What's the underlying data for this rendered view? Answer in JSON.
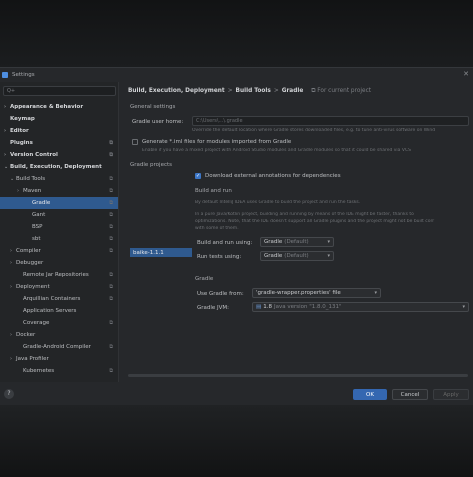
{
  "window": {
    "title": "Settings"
  },
  "search": {
    "placeholder": "Q+"
  },
  "tree": [
    {
      "label": "Appearance & Behavior",
      "level": 0,
      "arrow": ">",
      "bold": true
    },
    {
      "label": "Keymap",
      "level": 0,
      "bold": true
    },
    {
      "label": "Editor",
      "level": 0,
      "arrow": ">",
      "bold": true
    },
    {
      "label": "Plugins",
      "level": 0,
      "bold": true,
      "gear": true
    },
    {
      "label": "Version Control",
      "level": 0,
      "arrow": ">",
      "bold": true,
      "gear": true
    },
    {
      "label": "Build, Execution, Deployment",
      "level": 0,
      "arrow": "v",
      "bold": true
    },
    {
      "label": "Build Tools",
      "level": 1,
      "arrow": "v",
      "gear": true
    },
    {
      "label": "Maven",
      "level": 2,
      "arrow": ">",
      "gear": true
    },
    {
      "label": "Gradle",
      "level": 3,
      "selected": true,
      "gear": true
    },
    {
      "label": "Gant",
      "level": 3,
      "gear": true
    },
    {
      "label": "BSP",
      "level": 3,
      "gear": true
    },
    {
      "label": "sbt",
      "level": 3,
      "gear": true
    },
    {
      "label": "Compiler",
      "level": 1,
      "arrow": ">",
      "gear": true
    },
    {
      "label": "Debugger",
      "level": 1,
      "arrow": ">"
    },
    {
      "label": "Remote Jar Repositories",
      "level": 2,
      "gear": true
    },
    {
      "label": "Deployment",
      "level": 1,
      "arrow": ">",
      "gear": true
    },
    {
      "label": "Arquillian Containers",
      "level": 2,
      "gear": true
    },
    {
      "label": "Application Servers",
      "level": 2
    },
    {
      "label": "Coverage",
      "level": 2,
      "gear": true
    },
    {
      "label": "Docker",
      "level": 1,
      "arrow": ">"
    },
    {
      "label": "Gradle-Android Compiler",
      "level": 2,
      "gear": true
    },
    {
      "label": "Java Profiler",
      "level": 1,
      "arrow": ">"
    },
    {
      "label": "Kubernetes",
      "level": 2,
      "gear": true
    }
  ],
  "breadcrumb": {
    "parts": [
      "Build, Execution, Deployment",
      "Build Tools",
      "Gradle"
    ],
    "separator": ">",
    "scope": "For current project"
  },
  "general": {
    "heading": "General settings",
    "user_home_label": "Gradle user home:",
    "user_home_value": "C:\\Users\\...\\.gradle",
    "user_home_help": "Override the default location where Gradle stores downloaded files, e.g. to tune anti-virus software on Wind",
    "iml_label": "Generate *.iml files for modules imported from Gradle",
    "iml_help": "Enable if you have a mixed project with Android Studio modules and Gradle modules so that it could be shared via VCS"
  },
  "projects": {
    "heading": "Gradle projects",
    "items": [
      "baike-1.1.1"
    ],
    "download_label": "Download external annotations for dependencies"
  },
  "build_run": {
    "heading": "Build and run",
    "help1": "By default IntelliJ IDEA uses Gradle to build the project and run the tasks.",
    "help2": "In a pure Java/Kotlin project, building and running by means of the IDE might be faster, thanks to",
    "help3": "optimizations. Note, that the IDE doesn't support all Gradle plugins and the project might not be built corr",
    "help4": "with some of them.",
    "build_label": "Build and run using:",
    "build_value": "Gradle",
    "build_default": "(Default)",
    "tests_label": "Run tests using:",
    "tests_value": "Gradle",
    "tests_default": "(Default)"
  },
  "gradle": {
    "heading": "Gradle",
    "use_from_label": "Use Gradle from:",
    "use_from_value": "'gradle-wrapper.properties' file",
    "jvm_label": "Gradle JVM:",
    "jvm_value": "1.8",
    "jvm_detail": "Java version \"1.8.0_131\""
  },
  "footer": {
    "help": "?",
    "ok": "OK",
    "cancel": "Cancel",
    "apply": "Apply"
  },
  "colors": {
    "accent": "#3467b1",
    "selection": "#2f5a8f",
    "background": "#26282b"
  }
}
